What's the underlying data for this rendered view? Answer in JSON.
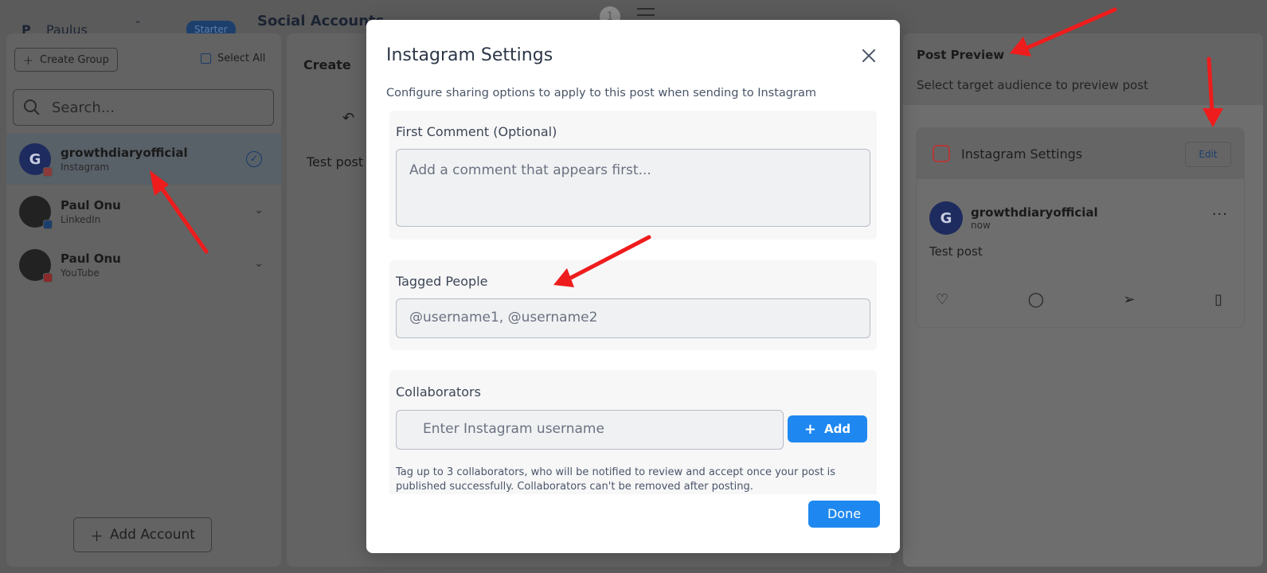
{
  "topbar": {
    "org_initial": "P",
    "org_name": "Paulus",
    "plan": "Starter",
    "title": "Social Accounts",
    "notif_count": "1"
  },
  "left": {
    "create_group": "Create Group",
    "select_all": "Select All",
    "search_placeholder": "Search...",
    "accounts": [
      {
        "name": "growthdiaryofficial",
        "platform": "Instagram",
        "selected": true
      },
      {
        "name": "Paul Onu",
        "platform": "LinkedIn",
        "selected": false
      },
      {
        "name": "Paul Onu",
        "platform": "YouTube",
        "selected": false
      }
    ],
    "add_account": "Add Account"
  },
  "middle": {
    "label": "Create",
    "post_text": "Test post"
  },
  "preview": {
    "title": "Post Preview",
    "subtitle": "Select target audience to preview post",
    "card_title": "Instagram Settings",
    "edit": "Edit",
    "username": "growthdiaryofficial",
    "time": "now",
    "body": "Test post"
  },
  "modal": {
    "title": "Instagram Settings",
    "subtitle": "Configure sharing options to apply to this post when sending to Instagram",
    "first_comment": {
      "label": "First Comment (Optional)",
      "placeholder": "Add a comment that appears first..."
    },
    "tagged": {
      "label": "Tagged People",
      "placeholder": "@username1, @username2"
    },
    "collaborators": {
      "label": "Collaborators",
      "placeholder": "Enter Instagram username",
      "add": "Add",
      "hint": "Tag up to 3 collaborators, who will be notified to review and accept once your post is published successfully. Collaborators can't be removed after posting."
    },
    "done": "Done"
  },
  "colors": {
    "primary": "#1e88f0",
    "arrow": "#ee1c1c",
    "brand_dark": "#1d2b5e"
  }
}
